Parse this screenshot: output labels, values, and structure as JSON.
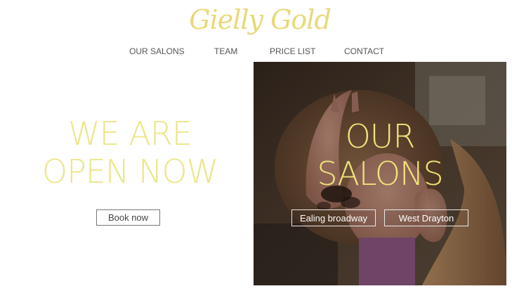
{
  "brand": {
    "logo_text": "Gielly Gold"
  },
  "nav": {
    "items": [
      {
        "label": "OUR SALONS"
      },
      {
        "label": "TEAM"
      },
      {
        "label": "PRICE LIST"
      },
      {
        "label": "CONTACT"
      }
    ]
  },
  "hero": {
    "line1": "WE ARE",
    "line2": "OPEN NOW",
    "cta_label": "Book now"
  },
  "salons": {
    "title_line1": "OUR",
    "title_line2": "SALONS",
    "locations": [
      {
        "label": "Ealing broadway"
      },
      {
        "label": "West Drayton"
      }
    ]
  },
  "colors": {
    "accent_gold": "#ece68a",
    "nav_text": "#555555",
    "button_border": "#777777"
  }
}
